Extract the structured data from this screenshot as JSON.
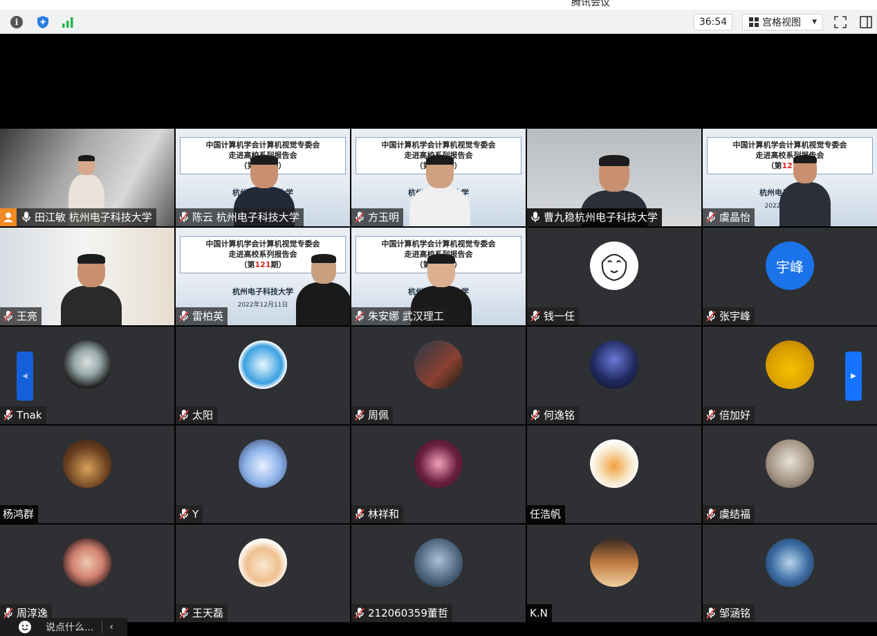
{
  "window": {
    "title": "腾讯会议"
  },
  "toolbar": {
    "timer": "36:54",
    "view_label": "宫格视图"
  },
  "slide": {
    "line1": "中国计算机学会计算机视觉专委会",
    "line2": "走进高校系列报告会",
    "issue_pre": "（第",
    "issue_num": "121",
    "issue_post": "期）",
    "school": "杭州电子科技大学",
    "date": "2022年12月11日"
  },
  "participants": [
    {
      "name": "田江敏 杭州电子科技大学"
    },
    {
      "name": "陈云 杭州电子科技大学"
    },
    {
      "name": "方玉明"
    },
    {
      "name": "曹九稳杭州电子科技大学"
    },
    {
      "name": "虞晶怡"
    },
    {
      "name": "王亮"
    },
    {
      "name": "雷柏英"
    },
    {
      "name": "朱安娜 武汉理工"
    },
    {
      "name": "钱一任"
    },
    {
      "name": "张宇峰",
      "avatar_text": "宇峰"
    },
    {
      "name": "Tnak"
    },
    {
      "name": "太阳"
    },
    {
      "name": "周佩"
    },
    {
      "name": "何逸铭"
    },
    {
      "name": "倍加好"
    },
    {
      "name": "杨鸿群"
    },
    {
      "name": "Y"
    },
    {
      "name": "林祥和"
    },
    {
      "name": "任浩帆"
    },
    {
      "name": "虞结福"
    },
    {
      "name": "周淳逸"
    },
    {
      "name": "王天磊"
    },
    {
      "name": "212060359董哲"
    },
    {
      "name": "K.N"
    },
    {
      "name": "邹涵铭"
    }
  ],
  "chat": {
    "placeholder": "说点什么..."
  },
  "colors": {
    "accent": "#1673ff",
    "tile_bg": "#2f3033",
    "host_badge": "#f08a24"
  }
}
